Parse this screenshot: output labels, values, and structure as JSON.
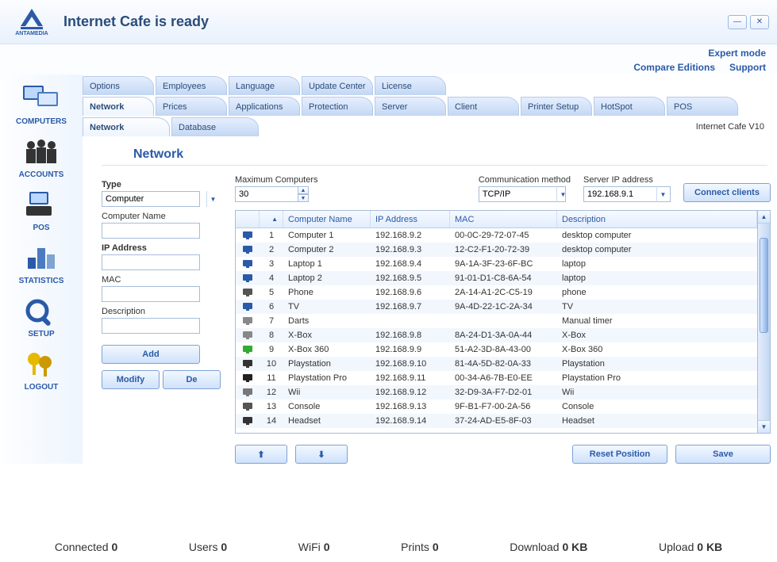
{
  "brand": "ANTAMEDIA",
  "title": "Internet Cafe is ready",
  "header_links": {
    "expert": "Expert mode",
    "compare": "Compare Editions",
    "support": "Support"
  },
  "sidebar": [
    {
      "key": "computers",
      "label": "COMPUTERS"
    },
    {
      "key": "accounts",
      "label": "ACCOUNTS"
    },
    {
      "key": "pos",
      "label": "POS"
    },
    {
      "key": "statistics",
      "label": "STATISTICS"
    },
    {
      "key": "setup",
      "label": "SETUP"
    },
    {
      "key": "logout",
      "label": "LOGOUT"
    }
  ],
  "tabs_top": [
    "Options",
    "Employees",
    "Language",
    "Update Center",
    "License"
  ],
  "tabs_main": [
    "Network",
    "Prices",
    "Applications",
    "Protection",
    "Server",
    "Client",
    "Printer Setup",
    "HotSpot",
    "POS"
  ],
  "tabs_main_active": 0,
  "tabs_sub": [
    "Network",
    "Database"
  ],
  "tabs_sub_active": 0,
  "version": "Internet Cafe V10",
  "section_heading": "Network",
  "form": {
    "type_label": "Type",
    "type_value": "Computer",
    "name_label": "Computer Name",
    "name_value": "",
    "ip_label": "IP Address",
    "ip_value": "",
    "mac_label": "MAC",
    "mac_value": "",
    "desc_label": "Description",
    "desc_value": "",
    "add": "Add",
    "modify": "Modify",
    "delete": "De"
  },
  "top_controls": {
    "max_label": "Maximum Computers",
    "max_value": "30",
    "comm_label": "Communication method",
    "comm_value": "TCP/IP",
    "server_label": "Server IP address",
    "server_value": "192.168.9.1",
    "connect": "Connect clients"
  },
  "columns": {
    "name": "Computer Name",
    "ip": "IP Address",
    "mac": "MAC",
    "desc": "Description"
  },
  "rows": [
    {
      "idx": 1,
      "icon": "monitor",
      "name": "Computer 1",
      "ip": "192.168.9.2",
      "mac": "00-0C-29-72-07-45",
      "desc": "desktop computer"
    },
    {
      "idx": 2,
      "icon": "monitor",
      "name": "Computer 2",
      "ip": "192.168.9.3",
      "mac": "12-C2-F1-20-72-39",
      "desc": "desktop computer"
    },
    {
      "idx": 3,
      "icon": "monitor",
      "name": "Laptop 1",
      "ip": "192.168.9.4",
      "mac": "9A-1A-3F-23-6F-BC",
      "desc": "laptop"
    },
    {
      "idx": 4,
      "icon": "monitor",
      "name": "Laptop 2",
      "ip": "192.168.9.5",
      "mac": "91-01-D1-C8-6A-54",
      "desc": "laptop"
    },
    {
      "idx": 5,
      "icon": "phone",
      "name": "Phone",
      "ip": "192.168.9.6",
      "mac": "2A-14-A1-2C-C5-19",
      "desc": "phone"
    },
    {
      "idx": 6,
      "icon": "tv",
      "name": "TV",
      "ip": "192.168.9.7",
      "mac": "9A-4D-22-1C-2A-34",
      "desc": "TV"
    },
    {
      "idx": 7,
      "icon": "timer",
      "name": "Darts",
      "ip": "",
      "mac": "",
      "desc": "Manual timer"
    },
    {
      "idx": 8,
      "icon": "xbox",
      "name": "X-Box",
      "ip": "192.168.9.8",
      "mac": "8A-24-D1-3A-0A-44",
      "desc": "X-Box"
    },
    {
      "idx": 9,
      "icon": "xbox360",
      "name": "X-Box 360",
      "ip": "192.168.9.9",
      "mac": "51-A2-3D-8A-43-00",
      "desc": "X-Box 360"
    },
    {
      "idx": 10,
      "icon": "ps",
      "name": "Playstation",
      "ip": "192.168.9.10",
      "mac": "81-4A-5D-82-0A-33",
      "desc": "Playstation"
    },
    {
      "idx": 11,
      "icon": "pspro",
      "name": "Playstation Pro",
      "ip": "192.168.9.11",
      "mac": "00-34-A6-7B-E0-EE",
      "desc": "Playstation Pro"
    },
    {
      "idx": 12,
      "icon": "wii",
      "name": "Wii",
      "ip": "192.168.9.12",
      "mac": "32-D9-3A-F7-D2-01",
      "desc": "Wii"
    },
    {
      "idx": 13,
      "icon": "console",
      "name": "Console",
      "ip": "192.168.9.13",
      "mac": "9F-B1-F7-00-2A-56",
      "desc": "Console"
    },
    {
      "idx": 14,
      "icon": "headset",
      "name": "Headset",
      "ip": "192.168.9.14",
      "mac": "37-24-AD-E5-8F-03",
      "desc": "Headset"
    }
  ],
  "bottom": {
    "reset": "Reset Position",
    "save": "Save"
  },
  "status": {
    "connected_label": "Connected",
    "connected_val": "0",
    "users_label": "Users",
    "users_val": "0",
    "wifi_label": "WiFi",
    "wifi_val": "0",
    "prints_label": "Prints",
    "prints_val": "0",
    "dl_label": "Download",
    "dl_val": "0 KB",
    "ul_label": "Upload",
    "ul_val": "0 KB"
  }
}
